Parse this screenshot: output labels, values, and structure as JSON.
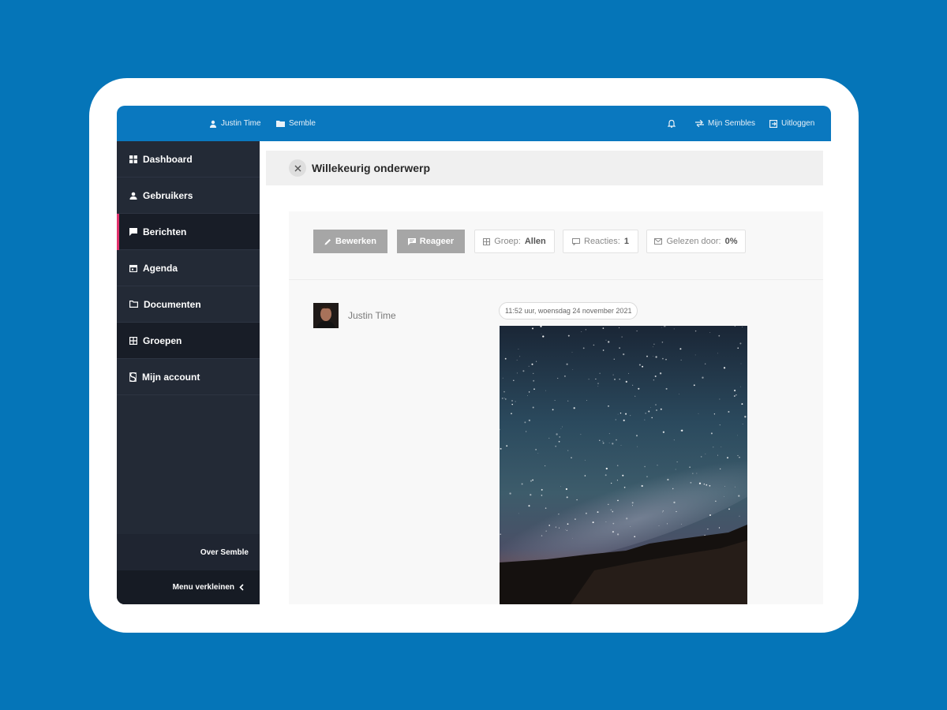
{
  "topbar": {
    "user_name": "Justin Time",
    "org_name": "Semble",
    "my_sembles_label": "Mijn Sembles",
    "logout_label": "Uitloggen"
  },
  "sidebar": {
    "items": [
      {
        "label": "Dashboard",
        "icon": "dashboard-icon"
      },
      {
        "label": "Gebruikers",
        "icon": "user-icon"
      },
      {
        "label": "Berichten",
        "icon": "message-icon",
        "active": true
      },
      {
        "label": "Agenda",
        "icon": "calendar-icon"
      },
      {
        "label": "Documenten",
        "icon": "folder-icon"
      },
      {
        "label": "Groepen",
        "icon": "groups-icon"
      },
      {
        "label": "Mijn account",
        "icon": "account-icon"
      }
    ],
    "about_label": "Over Semble",
    "collapse_label": "Menu verkleinen",
    "active_accent": "#e0306b"
  },
  "message": {
    "title": "Willekeurig onderwerp",
    "edit_label": "Bewerken",
    "reply_label": "Reageer",
    "group_prefix": "Groep:",
    "group_value": "Allen",
    "reactions_prefix": "Reacties:",
    "reactions_value": "1",
    "read_prefix": "Gelezen door:",
    "read_value": "0%",
    "author": "Justin Time",
    "timestamp": "11:52 uur, woensdag 24 november 2021"
  },
  "colors": {
    "background": "#0575b8",
    "topbar": "#0a78bf",
    "sidebar": "#232a36"
  }
}
